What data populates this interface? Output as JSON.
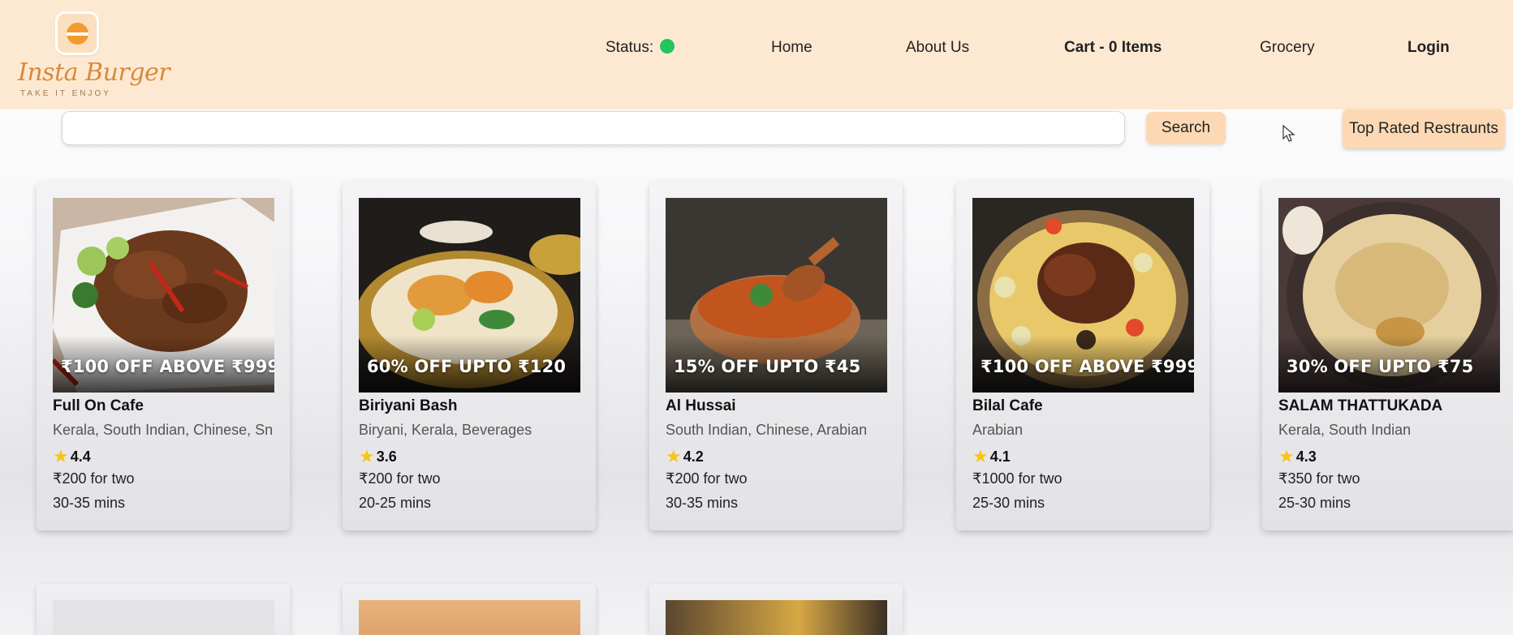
{
  "header": {
    "logo": {
      "name": "Insta Burger",
      "tagline": "TAKE IT ENJOY",
      "icon": "burger-icon"
    },
    "nav": {
      "status_label": "Status:",
      "status_color": "#22c55e",
      "home": "Home",
      "about": "About Us",
      "cart": "Cart - 0 Items",
      "grocery": "Grocery",
      "login": "Login"
    }
  },
  "search": {
    "value": "",
    "placeholder": "",
    "button_label": "Search",
    "top_rated_label": "Top Rated Restraunts"
  },
  "colors": {
    "header_bg": "#fde9d2",
    "button_bg": "#fcd9b4",
    "star": "#f5c518"
  },
  "restaurants": [
    {
      "offer": "₹100 OFF ABOVE ₹999",
      "name": "Full On Cafe",
      "cuisines": "Kerala, South Indian, Chinese, Sn",
      "rating": "4.4",
      "cost": "₹200 for two",
      "time": "30-35 mins"
    },
    {
      "offer": "60% OFF UPTO ₹120",
      "name": "Biriyani Bash",
      "cuisines": "Biryani, Kerala, Beverages",
      "rating": "3.6",
      "cost": "₹200 for two",
      "time": "20-25 mins"
    },
    {
      "offer": "15% OFF UPTO ₹45",
      "name": "Al Hussai",
      "cuisines": "South Indian, Chinese, Arabian",
      "rating": "4.2",
      "cost": "₹200 for two",
      "time": "30-35 mins"
    },
    {
      "offer": "₹100 OFF ABOVE ₹999",
      "name": "Bilal Cafe",
      "cuisines": "Arabian",
      "rating": "4.1",
      "cost": "₹1000 for two",
      "time": "25-30 mins"
    },
    {
      "offer": "30% OFF UPTO ₹75",
      "name": "SALAM THATTUKADA",
      "cuisines": "Kerala, South Indian",
      "rating": "4.3",
      "cost": "₹350 for two",
      "time": "25-30 mins"
    }
  ]
}
